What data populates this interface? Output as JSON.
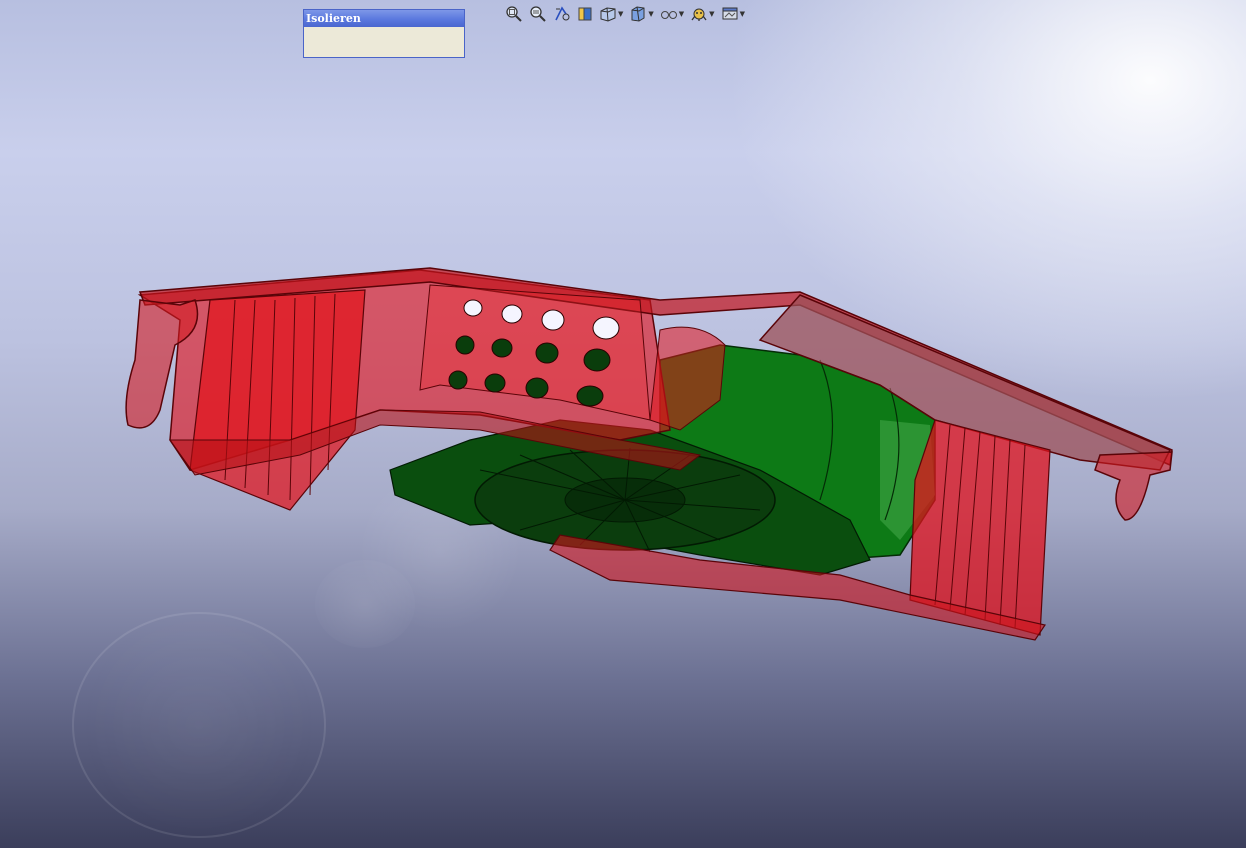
{
  "isolate_panel": {
    "title": "Isolieren"
  },
  "toolbar": {
    "buttons": [
      {
        "icon": "zoom-to-fit-icon"
      },
      {
        "icon": "zoom-to-area-icon"
      },
      {
        "icon": "previous-view-icon"
      },
      {
        "icon": "section-view-icon"
      },
      {
        "icon": "view-orientation-icon",
        "dropdown": true
      },
      {
        "icon": "display-style-icon",
        "dropdown": true
      },
      {
        "icon": "hide-show-items-icon",
        "dropdown": true
      },
      {
        "icon": "edit-appearance-icon",
        "dropdown": true
      },
      {
        "icon": "apply-scene-icon",
        "dropdown": true
      }
    ]
  },
  "colors": {
    "housing": "#d0141c",
    "fan": "#0b6a12",
    "panel_title": "#5a78de",
    "panel_body": "#ece9d8"
  }
}
